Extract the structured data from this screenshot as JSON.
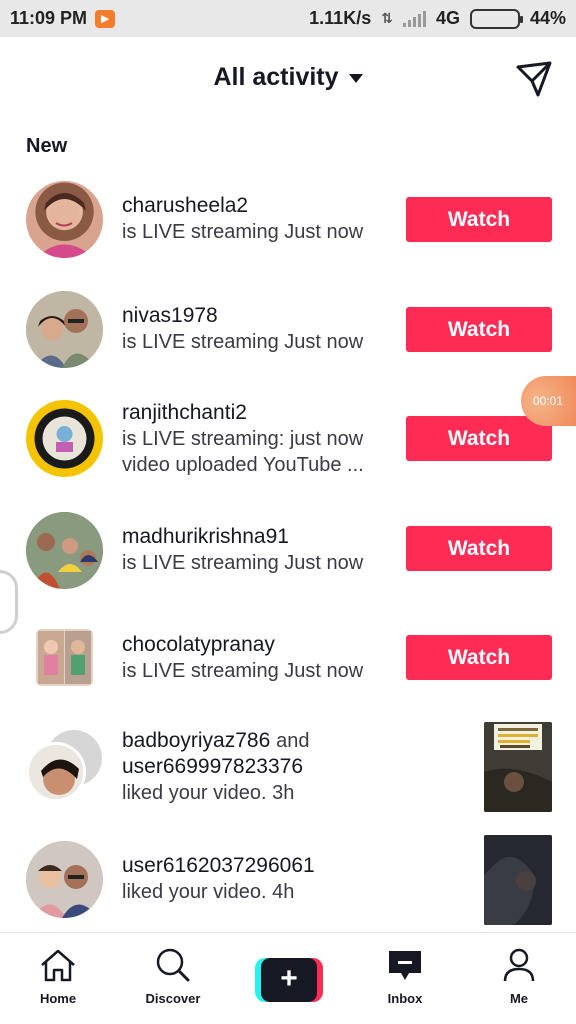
{
  "status_bar": {
    "time": "11:09 PM",
    "net_speed": "1.11K/s",
    "network": "4G",
    "battery": "44%",
    "battery_level": 0.44
  },
  "header": {
    "title": "All activity"
  },
  "section": {
    "label": "New"
  },
  "items": [
    {
      "username": "charusheela2",
      "desc": "is LIVE streaming Just now",
      "button": "Watch"
    },
    {
      "username": "nivas1978",
      "desc": "is LIVE streaming Just now",
      "button": "Watch"
    },
    {
      "username": "ranjithchanti2",
      "desc": "is LIVE streaming: just now",
      "desc2": "video uploaded YouTube ...",
      "button": "Watch"
    },
    {
      "username": "madhurikrishna91",
      "desc": "is LIVE streaming Just now",
      "button": "Watch"
    },
    {
      "username": "chocolatypranay",
      "desc": "is LIVE streaming Just now",
      "button": "Watch"
    },
    {
      "username": "badboyriyaz786",
      "and": "and",
      "username2": "user669997823376",
      "desc": "liked your video. 3h"
    },
    {
      "username": "user6162037296061",
      "desc": "liked your video. 4h"
    }
  ],
  "recording": {
    "time": "00:01"
  },
  "nav": {
    "home": "Home",
    "discover": "Discover",
    "create": "+",
    "inbox": "Inbox",
    "me": "Me"
  },
  "colors": {
    "accent": "#fe2c55",
    "cyan": "#25f4ee",
    "text": "#161823"
  }
}
